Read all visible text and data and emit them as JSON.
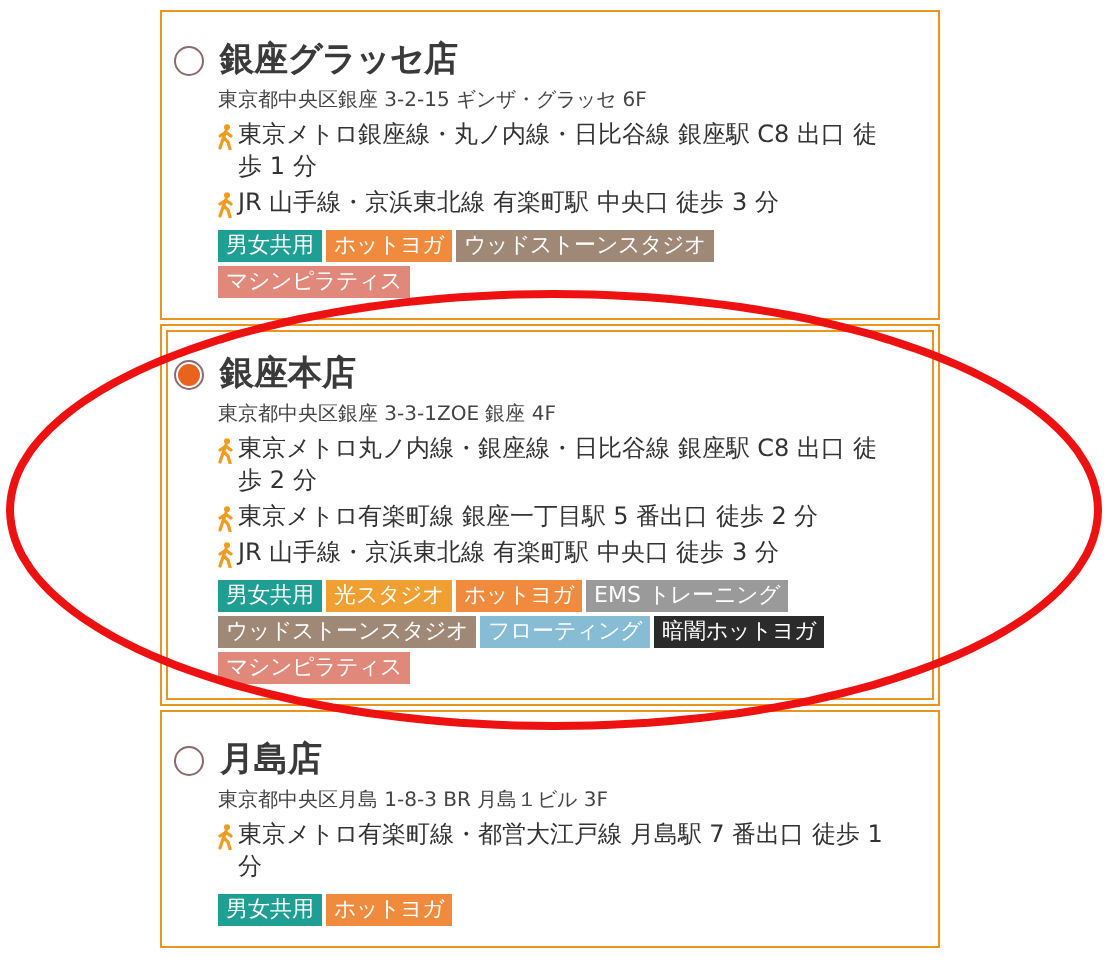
{
  "stores": [
    {
      "name": "銀座グラッセ店",
      "selected": false,
      "address": "東京都中央区銀座 3-2-15 ギンザ・グラッセ 6F",
      "routes": [
        "東京メトロ銀座線・丸ノ内線・日比谷線 銀座駅 C8 出口 徒歩 1 分",
        "JR 山手線・京浜東北線 有楽町駅 中央口 徒歩 3 分"
      ],
      "tags": [
        {
          "label": "男女共用",
          "color": "#1f9e94"
        },
        {
          "label": "ホットヨガ",
          "color": "#f08a3c"
        },
        {
          "label": "ウッドストーンスタジオ",
          "color": "#a08877"
        },
        {
          "label": "マシンピラティス",
          "color": "#e0887a"
        }
      ]
    },
    {
      "name": "銀座本店",
      "selected": true,
      "address": "東京都中央区銀座 3-3-1ZOE 銀座 4F",
      "routes": [
        "東京メトロ丸ノ内線・銀座線・日比谷線 銀座駅 C8 出口 徒歩 2 分",
        "東京メトロ有楽町線 銀座一丁目駅 5 番出口 徒歩 2 分",
        "JR 山手線・京浜東北線 有楽町駅 中央口 徒歩 3 分"
      ],
      "tags": [
        {
          "label": "男女共用",
          "color": "#1f9e94"
        },
        {
          "label": "光スタジオ",
          "color": "#f0a030"
        },
        {
          "label": "ホットヨガ",
          "color": "#f08a3c"
        },
        {
          "label": "EMS トレーニング",
          "color": "#9a9a9a"
        },
        {
          "label": "ウッドストーンスタジオ",
          "color": "#a08877"
        },
        {
          "label": "フローティング",
          "color": "#86bcd4"
        },
        {
          "label": "暗闇ホットヨガ",
          "color": "#2b2b2b"
        },
        {
          "label": "マシンピラティス",
          "color": "#e0887a"
        }
      ]
    },
    {
      "name": "月島店",
      "selected": false,
      "address": "東京都中央区月島 1-8-3 BR 月島１ビル 3F",
      "routes": [
        "東京メトロ有楽町線・都営大江戸線 月島駅 7 番出口 徒歩 1 分"
      ],
      "tags": [
        {
          "label": "男女共用",
          "color": "#1f9e94"
        },
        {
          "label": "ホットヨガ",
          "color": "#f08a3c"
        }
      ]
    }
  ]
}
